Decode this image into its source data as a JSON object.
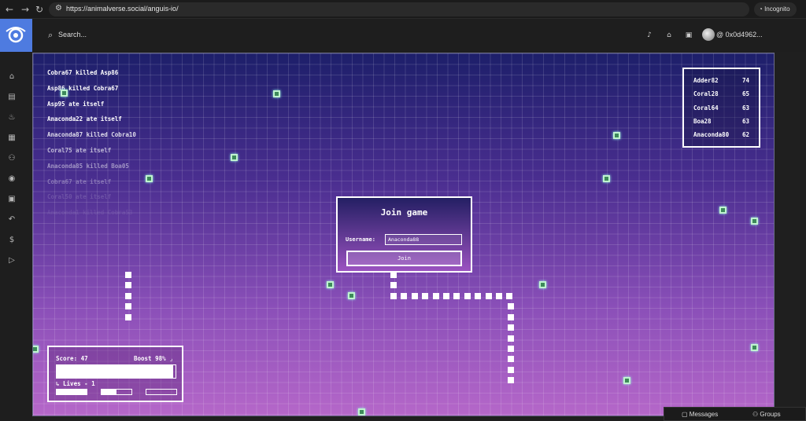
{
  "browser": {
    "url": "https://animalverse.social/anguis-io/",
    "incognito_label": "Incognito"
  },
  "header": {
    "search_placeholder": "Search...",
    "wallet_address": "@ 0x0d4962...",
    "icons": [
      "bell-icon",
      "store-icon",
      "bag-icon"
    ]
  },
  "sidebar": {
    "icons": [
      "home-icon",
      "document-icon",
      "fire-icon",
      "shop-icon",
      "users-icon",
      "gamepad-icon",
      "gift-icon",
      "arrow-icon",
      "coin-icon",
      "play-icon"
    ]
  },
  "game": {
    "kill_feed": [
      "Cobra67 killed Asp86",
      "Asp86 killed Cobra67",
      "Asp95 ate itself",
      "Anaconda22 ate itself",
      "Anaconda87 killed Cobra10",
      "Coral75 ate itself",
      "Anaconda85 killed Boa05",
      "Cobra67 ate itself",
      "Coral50 ate itself",
      "Anaconda1 killed Cobra53"
    ],
    "leaderboard": [
      {
        "name": "Adder82",
        "score": "74"
      },
      {
        "name": "Coral28",
        "score": "65"
      },
      {
        "name": "Coral64",
        "score": "63"
      },
      {
        "name": "Boa28",
        "score": "63"
      },
      {
        "name": "Anaconda80",
        "score": "62"
      }
    ],
    "join_dialog": {
      "title": "Join game",
      "username_label": "Username:",
      "username_value": "Anaconda88",
      "join_button": "Join"
    },
    "hud": {
      "score_label": "Score: 47",
      "boost_label": "Boost 98% ⌟",
      "boost_level": 0.98,
      "lives_label": "↳ Lives - 1",
      "lives_fill": [
        1.0,
        0.5,
        0.0
      ]
    }
  },
  "chat": {
    "messages_label": "Messages",
    "groups_label": "Groups"
  }
}
